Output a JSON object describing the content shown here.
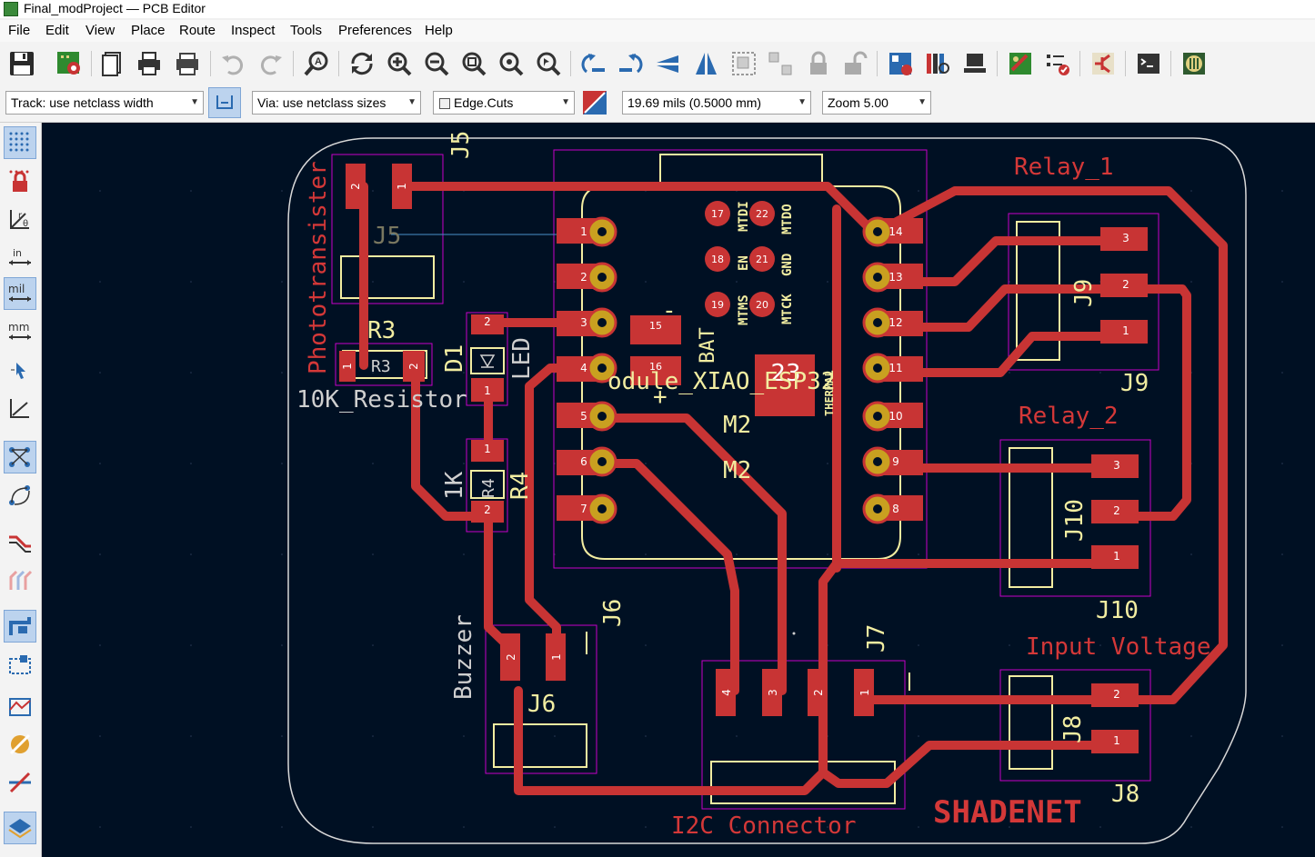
{
  "window": {
    "title": "Final_modProject — PCB Editor"
  },
  "menu": [
    "File",
    "Edit",
    "View",
    "Place",
    "Route",
    "Inspect",
    "Tools",
    "Preferences",
    "Help"
  ],
  "toolbar_icons": [
    "save-icon",
    "board-setup-icon",
    "page-settings-icon",
    "print-icon",
    "plot-icon",
    "undo-icon",
    "redo-icon",
    "find-icon",
    "refresh-icon",
    "zoom-in-icon",
    "zoom-out-icon",
    "zoom-fit-icon",
    "zoom-objects-icon",
    "zoom-selection-icon",
    "rotate-ccw-icon",
    "rotate-cw-icon",
    "flip-vertical-icon",
    "mirror-icon",
    "group-icon",
    "ungroup-icon",
    "lock-icon",
    "unlock-icon",
    "netlist-icon",
    "footprint-library-icon",
    "footprint-editor-icon",
    "drc-icon",
    "rule-checker-icon",
    "schematic-icon",
    "scripting-console-icon",
    "plugin-icon"
  ],
  "options": {
    "track": "Track: use netclass width",
    "via": "Via: use netclass sizes",
    "layer": "Edge.Cuts",
    "grid": "19.69 mils (0.5000 mm)",
    "zoom": "Zoom 5.00"
  },
  "left_tools": [
    "grid-dots-icon",
    "lock-layer-icon",
    "polar-coords-icon",
    "inches-icon",
    "mils-icon",
    "millimeters-icon",
    "cursor-icon",
    "crosshair-icon",
    "ratsnest-icon",
    "curved-ratsnest-icon",
    "track-outline-icon",
    "via-outline-icon",
    "pad-outline-icon",
    "zone-outline-icon",
    "zone-fill-icon",
    "hide-icon",
    "net-highlight-icon",
    "layers-icon"
  ],
  "pcb": {
    "labels": {
      "j5": "J5",
      "phototransistor": "Phototransister",
      "r3": "R3",
      "r3_value": "10K_Resistor",
      "d1": "D1",
      "led": "LED",
      "r4": "R4",
      "r4_value": "1K",
      "buzzer": "Buzzer",
      "j6": "J6",
      "j7": "J7",
      "i2c": "I2C Connector",
      "m2": "M2",
      "module": "odule_XIAO_ESP32",
      "bat": "BAT",
      "thermal": "THERMAL",
      "relay1": "Relay_1",
      "j9": "J9",
      "relay2": "Relay_2",
      "j10": "J10",
      "input_voltage": "Input Voltage",
      "j8": "J8",
      "shadenet": "SHADENET"
    },
    "mcu_left_pins": [
      "1",
      "2",
      "3",
      "4",
      "5",
      "6",
      "7"
    ],
    "mcu_right_pins": [
      "14",
      "13",
      "12",
      "11",
      "10",
      "9",
      "8"
    ],
    "mcu_center_pads": [
      "17",
      "22",
      "18",
      "21",
      "19",
      "20",
      "15",
      "16",
      "23"
    ],
    "mcu_center_labels": [
      "MTDI",
      "MTDO",
      "EN",
      "GND",
      "MTMS",
      "MTCK"
    ]
  },
  "colors": {
    "canvas": "#001023",
    "copper": "#c83434",
    "silk": "#f2eda1",
    "courtyard": "#c800c8",
    "pad_gold": "#d0a020"
  }
}
